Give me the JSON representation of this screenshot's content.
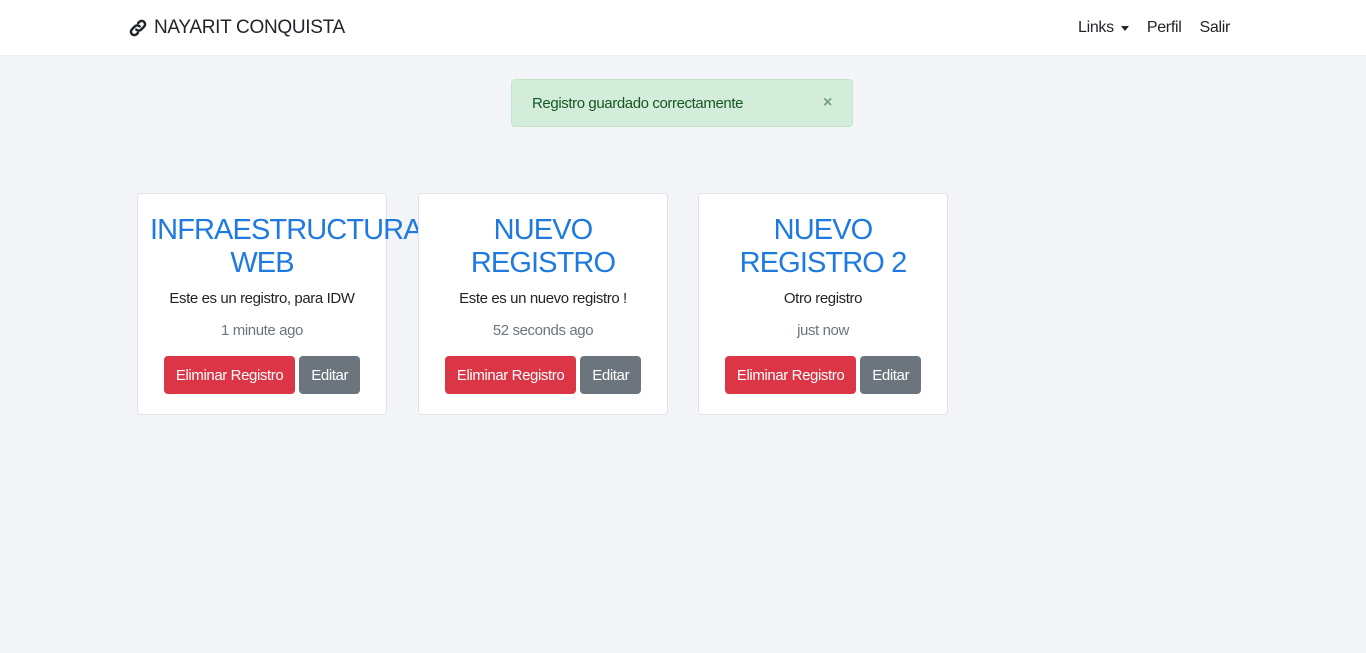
{
  "navbar": {
    "brand": "NAYARIT CONQUISTA",
    "brand_icon": "link-icon",
    "links": [
      {
        "label": "Links",
        "dropdown": true
      },
      {
        "label": "Perfil"
      },
      {
        "label": "Salir"
      }
    ]
  },
  "alert": {
    "message": "Registro guardado correctamente",
    "close": "×",
    "color": "#155724",
    "background": "#d4edda"
  },
  "cards": [
    {
      "title": "INFRAESTRUCTURA WEB",
      "description": "Este es un registro, para IDW",
      "time": "1 minute ago",
      "delete_label": "Eliminar Registro",
      "edit_label": "Editar"
    },
    {
      "title": "NUEVO REGISTRO",
      "description": "Este es un nuevo registro !",
      "time": "52 seconds ago",
      "delete_label": "Eliminar Registro",
      "edit_label": "Editar"
    },
    {
      "title": "NUEVO REGISTRO 2",
      "description": "Otro registro",
      "time": "just now",
      "delete_label": "Eliminar Registro",
      "edit_label": "Editar"
    }
  ],
  "colors": {
    "title": "#1f7ae0",
    "danger": "#dc3545",
    "secondary": "#6c757d",
    "background": "#f3f5f9"
  }
}
